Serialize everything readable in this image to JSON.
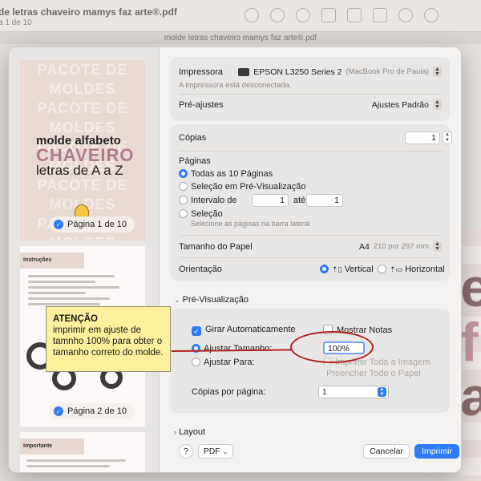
{
  "background": {
    "window_title": "de letras chaveiro mamys faz arte®.pdf",
    "window_subtitle": "a 1 de 10",
    "document_title": "molde letras chaveiro mamys faz arte®.pdf",
    "big_letters": [
      "e",
      "f",
      "a"
    ]
  },
  "sidebar": {
    "page1": {
      "title_line1": "molde alfabeto",
      "title_line2": "CHAVEIRO",
      "title_line3": "letras de A a Z",
      "pattern": "PACOTE DE MOLDES",
      "badge": "Página 1 de 10"
    },
    "page2": {
      "heading": "Instruções",
      "badge": "Página 2 de 10"
    },
    "page3": {
      "heading": "Importante"
    },
    "check_glyph": "✓"
  },
  "printer": {
    "label": "Impressora",
    "name": "EPSON L3250 Series 2",
    "host": "(MacBook Pro de Paula)",
    "status": "A impressora está desconectada.",
    "presets_label": "Pré-ajustes",
    "presets_value": "Ajustes Padrão"
  },
  "copies": {
    "label": "Cópias",
    "value": "1"
  },
  "pages": {
    "label": "Páginas",
    "all": "Todas as 10 Páginas",
    "selection_preview": "Seleção em Pré-Visualização",
    "range_label": "Intervalo de",
    "range_from": "1",
    "range_to_label": "até",
    "range_to": "1",
    "selection": "Seleção",
    "selection_hint": "Selecione as páginas na barra lateral"
  },
  "paper": {
    "label": "Tamanho do Papel",
    "size": "A4",
    "dims": "210 por 297 mm"
  },
  "orientation": {
    "label": "Orientação",
    "portrait": "Vertical",
    "landscape": "Horizontal"
  },
  "preview": {
    "section_label": "Pré-Visualização",
    "auto_rotate": "Girar Automaticamente",
    "show_notes": "Mostrar Notas",
    "scale_label": "Ajustar Tamanho:",
    "scale_value": "100%",
    "fit_label": "Ajustar Para:",
    "print_entire": "Imprimir Toda a Imagem",
    "fill_entire": "Preencher Todo o Papel",
    "copies_per_page_label": "Cópias por página:",
    "copies_per_page_value": "1"
  },
  "layout": {
    "section_label": "Layout"
  },
  "footer": {
    "help": "?",
    "pdf": "PDF",
    "cancel": "Cancelar",
    "print": "Imprimir"
  },
  "annotation": {
    "title": "ATENÇÃO",
    "body": "imprimir em ajuste de tamnho 100% para obter o tamanho correto do molde."
  },
  "colors": {
    "accent": "#2d7cf6",
    "note_bg": "#fbf09b",
    "annotation_red": "#b51e1e"
  }
}
